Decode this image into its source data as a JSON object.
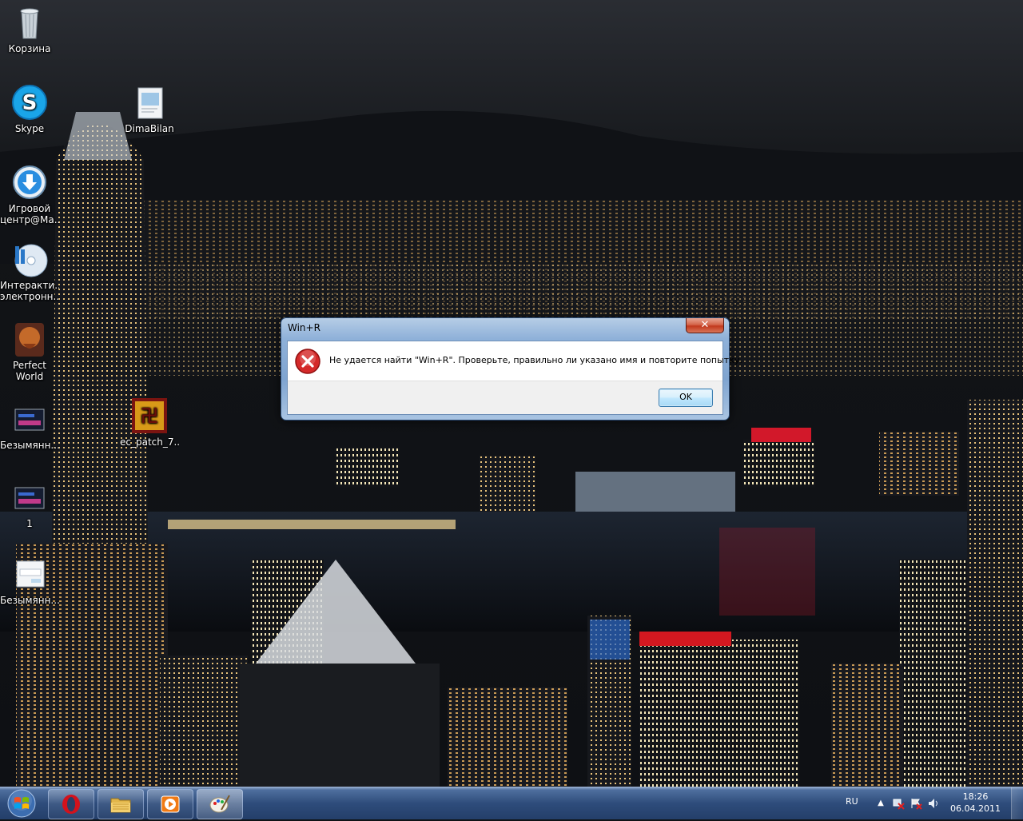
{
  "desktop": {
    "icons": [
      {
        "label": "Корзина"
      },
      {
        "label": "Skype"
      },
      {
        "label": "DimaBilan"
      },
      {
        "label": "Игровой центр@Ma..."
      },
      {
        "label": "Интеракти... электронн..."
      },
      {
        "label": "Perfect World"
      },
      {
        "label": "Безымянн..."
      },
      {
        "label": "ec_patch_7..."
      },
      {
        "label": "1"
      },
      {
        "label": "Безымянн..."
      }
    ]
  },
  "dialog": {
    "title": "Win+R",
    "close_glyph": "✕",
    "message": "Не удается найти \"Win+R\". Проверьте, правильно ли указано имя и повторите попытку.",
    "ok_label": "OK",
    "icon": "error-icon"
  },
  "taskbar": {
    "pinned": [
      {
        "name": "opera",
        "icon": "opera-icon"
      },
      {
        "name": "explorer",
        "icon": "folder-icon"
      },
      {
        "name": "media-player",
        "icon": "media-player-icon"
      },
      {
        "name": "paint",
        "icon": "paint-icon"
      }
    ],
    "language": "RU",
    "time": "18:26",
    "date": "06.04.2011"
  },
  "colors": {
    "taskbar": "#2e4c7b",
    "dialog_frame": "#8fb1d9",
    "close_button": "#c1391d",
    "error_red": "#d42a2a"
  }
}
